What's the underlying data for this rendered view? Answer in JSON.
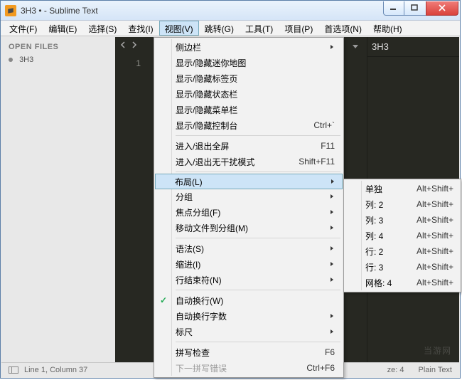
{
  "window": {
    "title": "3H3 • - Sublime Text"
  },
  "menubar": {
    "items": [
      {
        "label": "文件(F)"
      },
      {
        "label": "编辑(E)"
      },
      {
        "label": "选择(S)"
      },
      {
        "label": "查找(I)"
      },
      {
        "label": "视图(V)",
        "active": true
      },
      {
        "label": "跳转(G)"
      },
      {
        "label": "工具(T)"
      },
      {
        "label": "项目(P)"
      },
      {
        "label": "首选项(N)"
      },
      {
        "label": "帮助(H)"
      }
    ]
  },
  "sidebar": {
    "header": "OPEN FILES",
    "files": [
      {
        "name": "3H3"
      }
    ]
  },
  "gutter": {
    "line": "1"
  },
  "pane2": {
    "tab": "3H3"
  },
  "statusbar": {
    "position": "Line 1, Column 37",
    "size_label": "ze: 4",
    "syntax": "Plain Text"
  },
  "view_menu": {
    "items": [
      {
        "label": "侧边栏",
        "submenu": true
      },
      {
        "label": "显示/隐藏迷你地图"
      },
      {
        "label": "显示/隐藏标签页"
      },
      {
        "label": "显示/隐藏状态栏"
      },
      {
        "label": "显示/隐藏菜单栏"
      },
      {
        "label": "显示/隐藏控制台",
        "shortcut": "Ctrl+`"
      },
      {
        "sep": true
      },
      {
        "label": "进入/退出全屏",
        "shortcut": "F11"
      },
      {
        "label": "进入/退出无干扰模式",
        "shortcut": "Shift+F11"
      },
      {
        "sep": true
      },
      {
        "label": "布局(L)",
        "submenu": true,
        "highlight": true
      },
      {
        "label": "分组",
        "submenu": true
      },
      {
        "label": "焦点分组(F)",
        "submenu": true
      },
      {
        "label": "移动文件到分组(M)",
        "submenu": true
      },
      {
        "sep": true
      },
      {
        "label": "语法(S)",
        "submenu": true
      },
      {
        "label": "缩进(I)",
        "submenu": true
      },
      {
        "label": "行结束符(N)",
        "submenu": true
      },
      {
        "sep": true
      },
      {
        "label": "自动换行(W)",
        "checked": true
      },
      {
        "label": "自动换行字数",
        "submenu": true
      },
      {
        "label": "标尺",
        "submenu": true
      },
      {
        "sep": true
      },
      {
        "label": "拼写检查",
        "shortcut": "F6"
      },
      {
        "label": "下一拼写错误",
        "shortcut": "Ctrl+F6",
        "disabled": true
      }
    ]
  },
  "layout_submenu": {
    "items": [
      {
        "label": "单独",
        "shortcut": "Alt+Shift+"
      },
      {
        "label": "列: 2",
        "shortcut": "Alt+Shift+"
      },
      {
        "label": "列: 3",
        "shortcut": "Alt+Shift+"
      },
      {
        "label": "列: 4",
        "shortcut": "Alt+Shift+"
      },
      {
        "label": "行: 2",
        "shortcut": "Alt+Shift+"
      },
      {
        "label": "行: 3",
        "shortcut": "Alt+Shift+"
      },
      {
        "label": "网格: 4",
        "shortcut": "Alt+Shift+"
      }
    ]
  },
  "watermark": "当游网"
}
